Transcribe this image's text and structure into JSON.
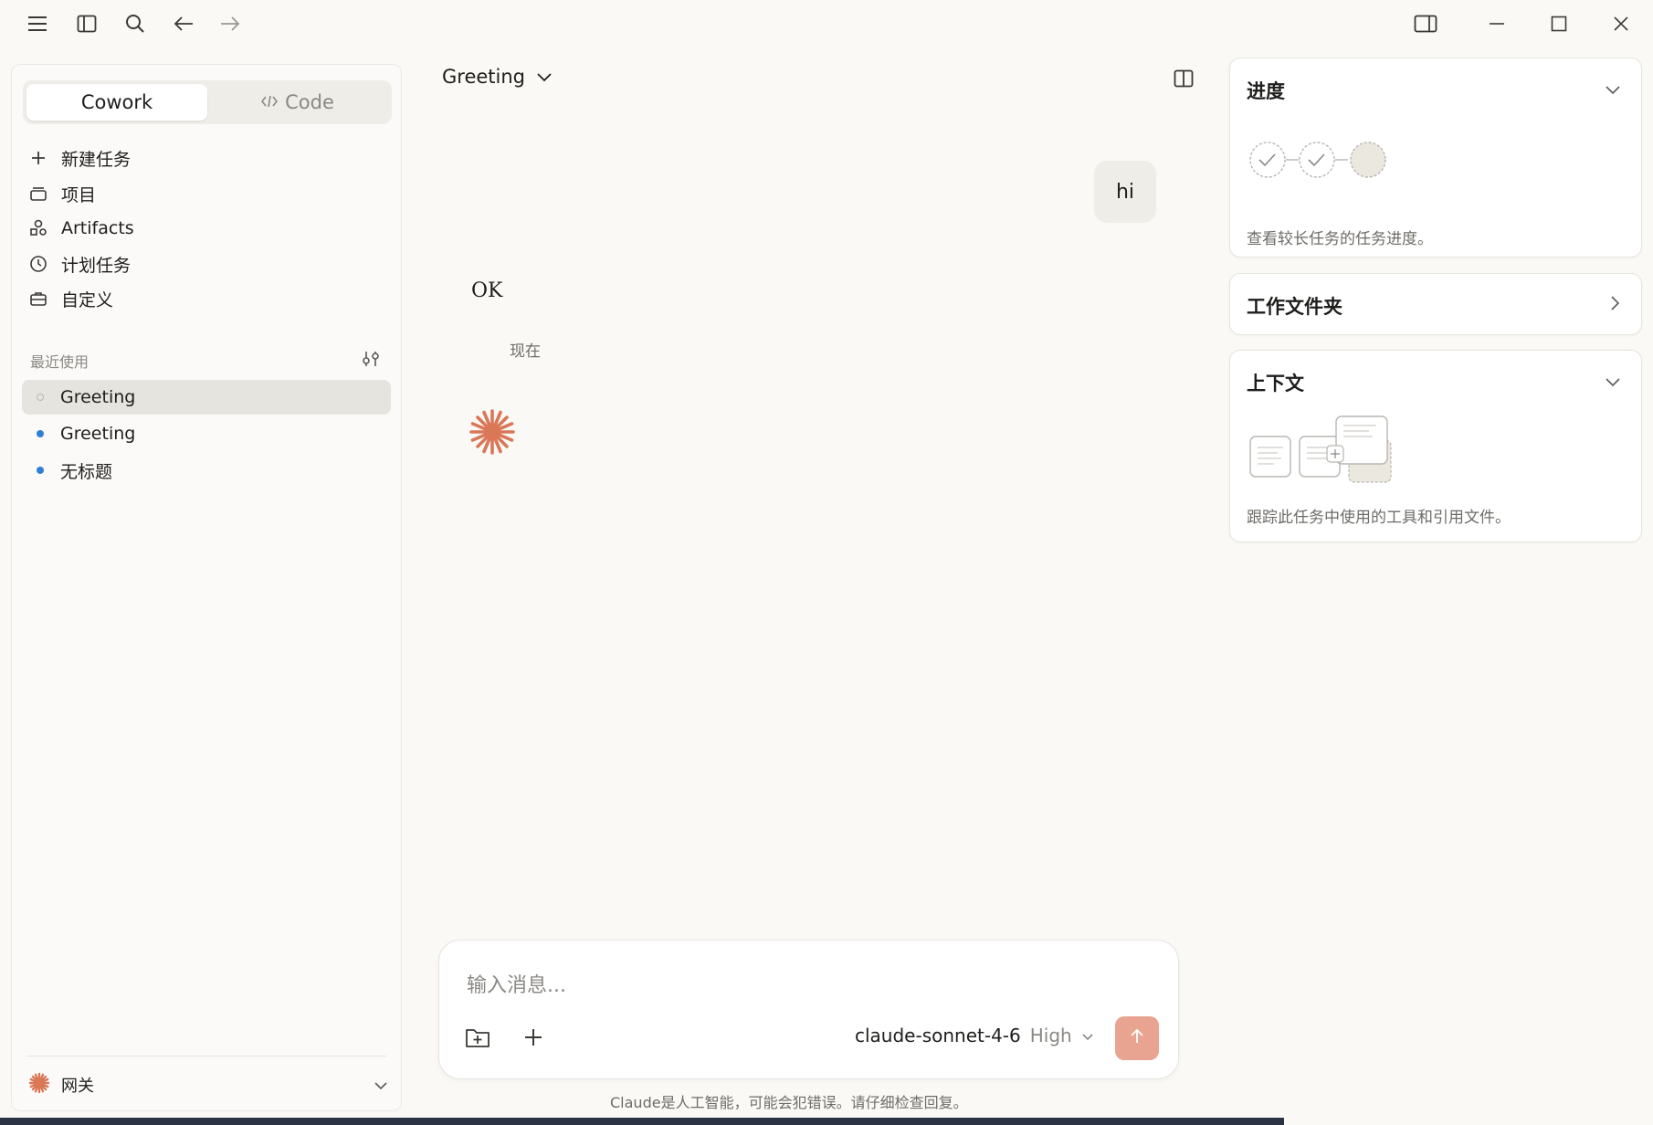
{
  "sidebar": {
    "modes": [
      {
        "label": "Cowork",
        "active": true
      },
      {
        "label": "Code",
        "active": false
      }
    ],
    "nav": [
      {
        "label": "新建任务",
        "icon": "plus-icon"
      },
      {
        "label": "项目",
        "icon": "folder-stack-icon"
      },
      {
        "label": "Artifacts",
        "icon": "shapes-icon"
      },
      {
        "label": "计划任务",
        "icon": "clock-icon"
      },
      {
        "label": "自定义",
        "icon": "briefcase-icon"
      }
    ],
    "recent_label": "最近使用",
    "recent": [
      {
        "label": "Greeting",
        "active": true
      },
      {
        "label": "Greeting",
        "active": false
      },
      {
        "label": "无标题",
        "active": false
      }
    ],
    "footer_label": "网关"
  },
  "conversation": {
    "title": "Greeting",
    "user_message": "hi",
    "assistant_message": "OK",
    "timestamp": "现在"
  },
  "composer": {
    "placeholder": "输入消息...",
    "model": "claude-sonnet-4-6",
    "effort": "High",
    "disclaimer": "Claude是人工智能，可能会犯错误。请仔细检查回复。"
  },
  "right_panel": {
    "progress": {
      "title": "进度",
      "desc": "查看较长任务的任务进度。",
      "steps_done": 2,
      "steps_total": 3
    },
    "folder": {
      "title": "工作文件夹"
    },
    "context": {
      "title": "上下文",
      "desc": "跟踪此任务中使用的工具和引用文件。"
    }
  },
  "colors": {
    "accent": "#d97757",
    "send": "#e8a391",
    "unread_dot": "#2f7fd4"
  }
}
